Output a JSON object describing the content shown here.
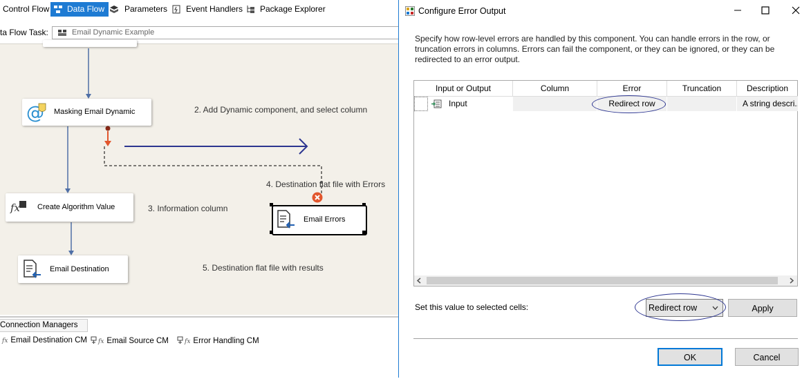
{
  "tabs": [
    {
      "label": "Control Flow"
    },
    {
      "label": "Data Flow"
    },
    {
      "label": "Parameters"
    },
    {
      "label": "Event Handlers"
    },
    {
      "label": "Package Explorer"
    }
  ],
  "task": {
    "label": "ta Flow Task:",
    "value": "Email Dynamic Example"
  },
  "canvas": {
    "components": {
      "masking": "Masking Email Dynamic",
      "algorithm": "Create Algorithm Value",
      "destination": "Email Destination",
      "errors": "Email Errors"
    },
    "notes": {
      "step2": "2. Add Dynamic component, and select column",
      "step3": "3. Information column",
      "step4": "4. Destination flat file with Errors",
      "step5": "5. Destination flat file with results"
    }
  },
  "connection_managers": {
    "tab": "Connection Managers",
    "items": [
      {
        "label": "Email Destination CM"
      },
      {
        "label": "Email Source CM"
      },
      {
        "label": "Error Handling CM"
      }
    ],
    "fx": "fx"
  },
  "dialog": {
    "title": "Configure Error Output",
    "description": "Specify how row-level errors are handled by this component. You can handle errors in the row, or truncation errors in columns. Errors can fail the component, or they can be ignored, or they can be redirected to an error output.",
    "columns": [
      "Input or Output",
      "Column",
      "Error",
      "Truncation",
      "Description"
    ],
    "rows": [
      {
        "input": "Input",
        "column": "",
        "error": "Redirect row",
        "truncation": "",
        "description": "A string descri..."
      }
    ],
    "set_label": "Set this value to selected cells:",
    "set_value": "Redirect row",
    "apply": "Apply",
    "ok": "OK",
    "cancel": "Cancel"
  },
  "colors": {
    "accent": "#1e7bd3",
    "annotation": "#2c3590",
    "error": "#e2562d"
  }
}
